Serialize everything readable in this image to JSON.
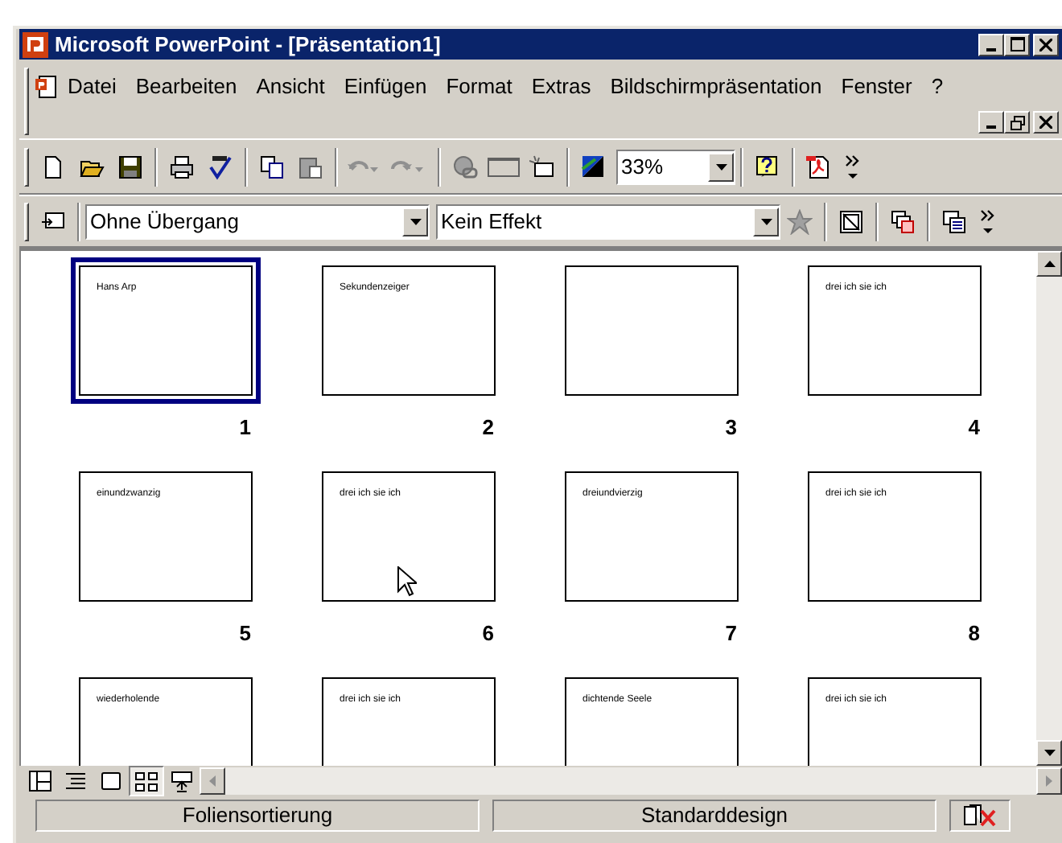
{
  "window": {
    "title": "Microsoft PowerPoint - [Präsentation1]"
  },
  "menu": [
    "Datei",
    "Bearbeiten",
    "Ansicht",
    "Einfügen",
    "Format",
    "Extras",
    "Bildschirmpräsentation",
    "Fenster",
    "?"
  ],
  "standard_toolbar": {
    "zoom": "33%"
  },
  "effects_toolbar": {
    "transition": "Ohne Übergang",
    "effect": "Kein Effekt"
  },
  "slides": [
    {
      "number": "1",
      "title": "Hans Arp",
      "selected": true
    },
    {
      "number": "2",
      "title": "Sekundenzeiger",
      "selected": false
    },
    {
      "number": "3",
      "selected": false
    },
    {
      "number": "4",
      "title": "drei ich sie ich",
      "selected": false
    },
    {
      "number": "5",
      "title": "einundzwanzig",
      "selected": false
    },
    {
      "number": "6",
      "title": "drei ich sie ich",
      "selected": false
    },
    {
      "number": "7",
      "title": "dreiundvierzig",
      "selected": false
    },
    {
      "number": "8",
      "title": "drei ich sie ich",
      "selected": false
    },
    {
      "title": "wiederholende",
      "selected": false
    },
    {
      "title": "drei ich sie ich",
      "selected": false
    },
    {
      "title": "dichtende Seele",
      "selected": false
    },
    {
      "title": "drei ich sie ich",
      "selected": false
    }
  ],
  "view_buttons": [
    {
      "kind": "normal",
      "selected": false
    },
    {
      "kind": "outline",
      "selected": false
    },
    {
      "kind": "slide",
      "selected": false
    },
    {
      "kind": "sorter",
      "selected": true
    },
    {
      "kind": "show",
      "selected": false
    }
  ],
  "status_bar": [
    "Foliensortierung",
    "Standarddesign"
  ]
}
